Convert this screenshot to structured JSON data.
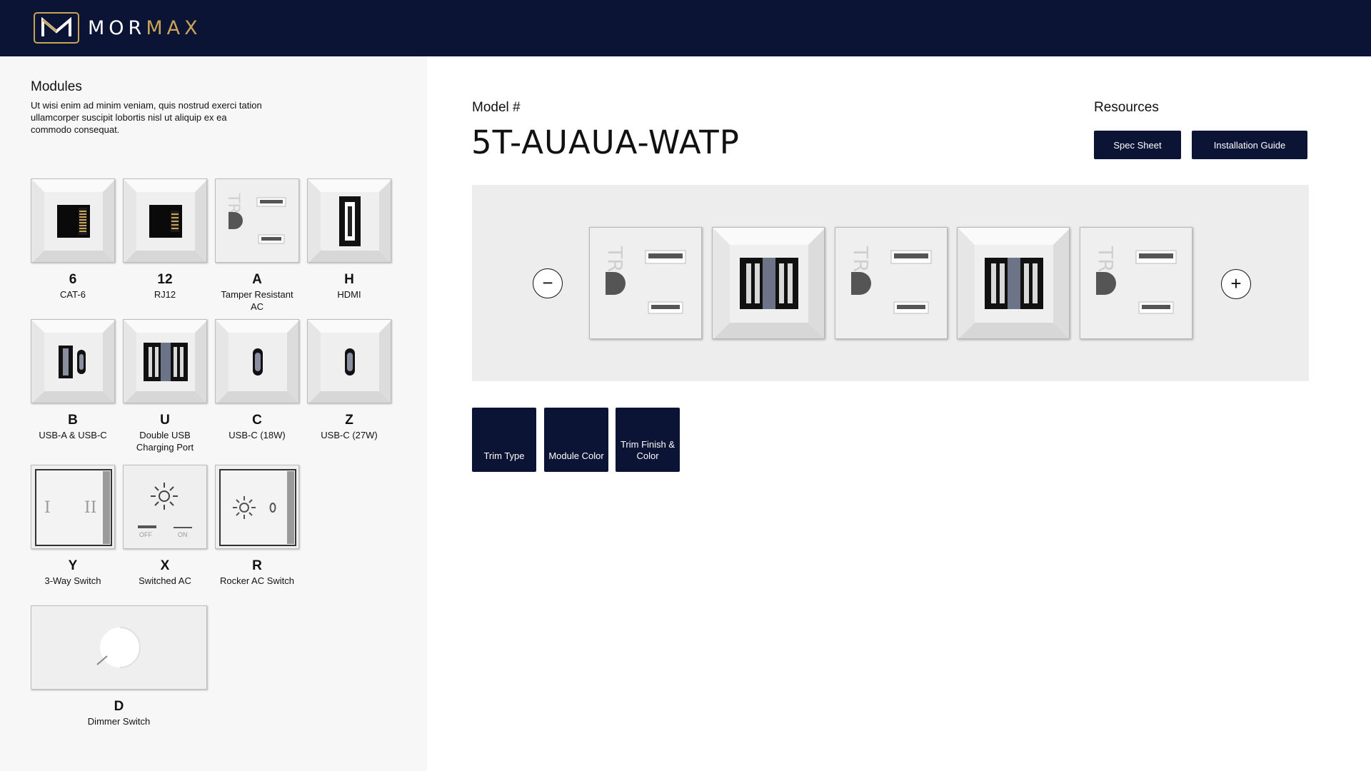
{
  "brand": {
    "word_a": "MOR",
    "word_b": "MAX",
    "accent": "#c9a456",
    "navy": "#0c1436"
  },
  "sidebar": {
    "title": "Modules",
    "description": "Ut wisi enim ad minim veniam, quis nostrud exerci tation ullamcorper suscipit lobortis nisl ut aliquip ex ea commodo consequat.",
    "modules": [
      {
        "code": "6",
        "name": "CAT-6",
        "icon": "ethernet-jack-icon"
      },
      {
        "code": "12",
        "name": "RJ12",
        "icon": "phone-jack-icon"
      },
      {
        "code": "A",
        "name": "Tamper Resistant AC",
        "icon": "ac-outlet-icon"
      },
      {
        "code": "H",
        "name": "HDMI",
        "icon": "hdmi-port-icon"
      },
      {
        "code": "B",
        "name": "USB-A & USB-C",
        "icon": "usb-a-c-icon"
      },
      {
        "code": "U",
        "name": "Double USB Charging Port",
        "icon": "double-usb-icon"
      },
      {
        "code": "C",
        "name": "USB-C (18W)",
        "icon": "usb-c-icon"
      },
      {
        "code": "Z",
        "name": "USB-C (27W)",
        "icon": "usb-c-icon"
      },
      {
        "code": "Y",
        "name": "3-Way Switch",
        "icon": "three-way-switch-icon",
        "labels": [
          "I",
          "II"
        ]
      },
      {
        "code": "X",
        "name": "Switched AC",
        "icon": "switched-ac-icon",
        "labels": [
          "OFF",
          "ON"
        ]
      },
      {
        "code": "R",
        "name": "Rocker AC Switch",
        "icon": "rocker-switch-icon"
      },
      {
        "code": "D",
        "name": "Dimmer Switch",
        "icon": "dimmer-switch-icon"
      }
    ]
  },
  "main": {
    "model_label": "Model #",
    "model_number": "5T-AUAUA-WATP",
    "resources_label": "Resources",
    "resources": [
      "Spec Sheet",
      "Installation Guide"
    ],
    "preview": {
      "remove_symbol": "−",
      "add_symbol": "+",
      "modules": [
        "A",
        "U",
        "A",
        "U",
        "A"
      ]
    },
    "options": [
      "Trim Type",
      "Module Color",
      "Trim Finish & Color"
    ]
  },
  "glyphs": {
    "tr_mark": "TR"
  }
}
